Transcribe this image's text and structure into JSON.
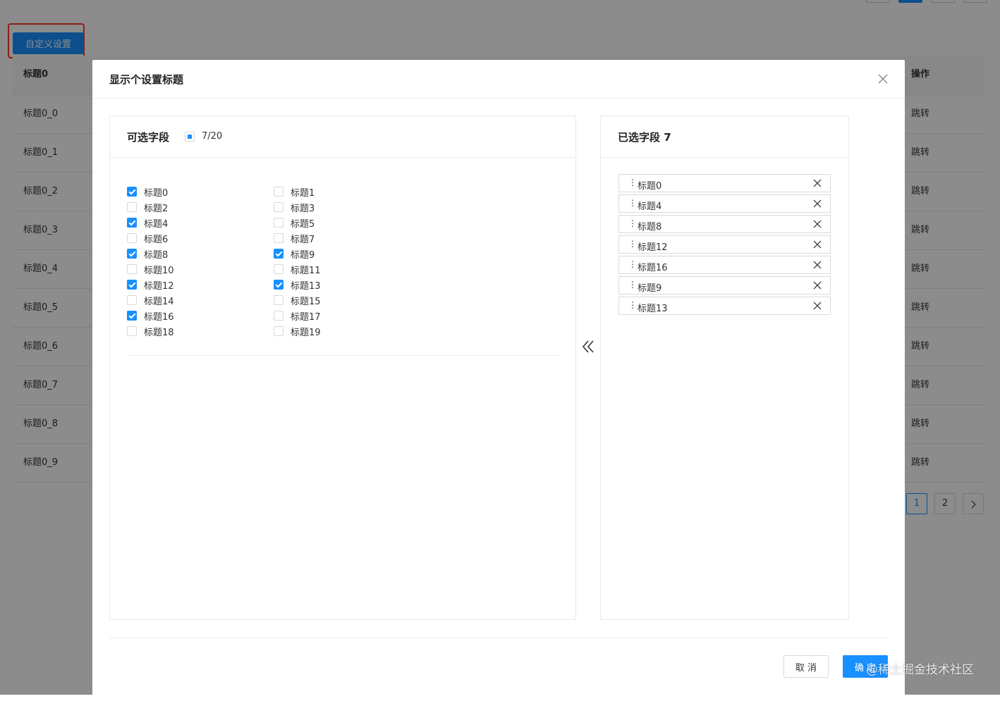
{
  "page": {
    "custom_button_label": "自定义设置",
    "table": {
      "header": {
        "col1": "标题0",
        "col2": "操作"
      },
      "rows": [
        {
          "col1": "标题0_0",
          "col2": "跳转"
        },
        {
          "col1": "标题0_1",
          "col2": "跳转"
        },
        {
          "col1": "标题0_2",
          "col2": "跳转"
        },
        {
          "col1": "标题0_3",
          "col2": "跳转"
        },
        {
          "col1": "标题0_4",
          "col2": "跳转"
        },
        {
          "col1": "标题0_5",
          "col2": "跳转"
        },
        {
          "col1": "标题0_6",
          "col2": "跳转"
        },
        {
          "col1": "标题0_7",
          "col2": "跳转"
        },
        {
          "col1": "标题0_8",
          "col2": "跳转"
        },
        {
          "col1": "标题0_9",
          "col2": "跳转"
        }
      ]
    },
    "pagination": {
      "pages": [
        "1",
        "2"
      ],
      "current": "1",
      "next_icon": "chevron-right-icon"
    }
  },
  "modal": {
    "title": "显示个设置标题",
    "close_icon": "close-icon",
    "left_panel": {
      "title": "可选字段",
      "count": "7/20",
      "options": [
        {
          "label": "标题0",
          "checked": true
        },
        {
          "label": "标题1",
          "checked": false
        },
        {
          "label": "标题2",
          "checked": false
        },
        {
          "label": "标题3",
          "checked": false
        },
        {
          "label": "标题4",
          "checked": true
        },
        {
          "label": "标题5",
          "checked": false
        },
        {
          "label": "标题6",
          "checked": false
        },
        {
          "label": "标题7",
          "checked": false
        },
        {
          "label": "标题8",
          "checked": true
        },
        {
          "label": "标题9",
          "checked": true
        },
        {
          "label": "标题10",
          "checked": false
        },
        {
          "label": "标题11",
          "checked": false
        },
        {
          "label": "标题12",
          "checked": true
        },
        {
          "label": "标题13",
          "checked": true
        },
        {
          "label": "标题14",
          "checked": false
        },
        {
          "label": "标题15",
          "checked": false
        },
        {
          "label": "标题16",
          "checked": true
        },
        {
          "label": "标题17",
          "checked": false
        },
        {
          "label": "标题18",
          "checked": false
        },
        {
          "label": "标题19",
          "checked": false
        }
      ]
    },
    "move_icon": "double-chevron-left-icon",
    "right_panel": {
      "title": "已选字段 7",
      "drag_handle": "⋮",
      "items": [
        "标题0",
        "标题4",
        "标题8",
        "标题12",
        "标题16",
        "标题9",
        "标题13"
      ]
    },
    "cancel_label": "取 消",
    "ok_label": "确 定"
  },
  "watermark": "@稀土掘金技术社区",
  "colors": {
    "primary": "#1890ff",
    "highlight_border": "#ff3b1f",
    "mask": "rgba(0,0,0,0.45)"
  }
}
